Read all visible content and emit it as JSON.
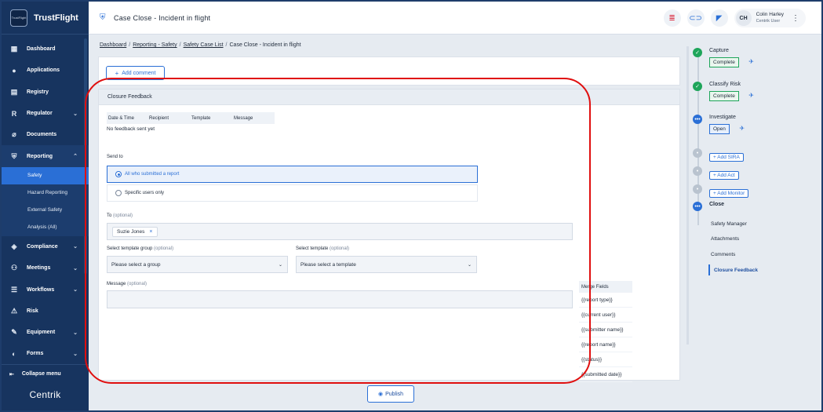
{
  "brand": {
    "name": "TrustFlight",
    "logo_text": "TrustFlight"
  },
  "sidebar": {
    "items": [
      {
        "label": "Dashboard",
        "icon": "dashboard-icon"
      },
      {
        "label": "Applications",
        "icon": "user-icon"
      },
      {
        "label": "Registry",
        "icon": "registry-icon"
      },
      {
        "label": "Regulator",
        "icon": "regulator-icon",
        "letter": "R"
      },
      {
        "label": "Documents",
        "icon": "paperclip-icon"
      },
      {
        "label": "Reporting",
        "icon": "shield-icon"
      },
      {
        "label": "Compliance",
        "icon": "compliance-icon"
      },
      {
        "label": "Meetings",
        "icon": "meetings-icon"
      },
      {
        "label": "Workflows",
        "icon": "workflows-icon"
      },
      {
        "label": "Risk",
        "icon": "risk-icon"
      },
      {
        "label": "Equipment",
        "icon": "wrench-icon"
      },
      {
        "label": "Forms",
        "icon": "forms-icon"
      }
    ],
    "reporting_sub": [
      "Safety",
      "Hazard Reporting",
      "External Safety",
      "Analysis (All)"
    ],
    "collapse_label": "Collapse menu",
    "footer_logo": "Centrik"
  },
  "header": {
    "title": "Case Close - Incident in flight",
    "user_initials": "CH",
    "user_name": "Colin Harley",
    "user_role": "Centrik User"
  },
  "breadcrumb": {
    "items": [
      "Dashboard",
      "Reporting - Safety",
      "Safety Case List",
      "Case Close - Incident in flight"
    ]
  },
  "main": {
    "add_comment_label": "Add comment",
    "panel_title": "Closure Feedback",
    "table_headers": [
      "Date & Time",
      "Recipient",
      "Template",
      "Message"
    ],
    "empty_text": "No feedback sent yet",
    "send_to_label": "Send to",
    "radio_all": "All who submitted a report",
    "radio_specific": "Specific users only",
    "to_label": "To",
    "optional": "(optional)",
    "to_chip": "Suzie Jones",
    "template_group_label": "Select template group",
    "template_group_placeholder": "Please select a group",
    "template_label": "Select template",
    "template_placeholder": "Please select a template",
    "message_label": "Message",
    "merge_fields_title": "Merge Fields",
    "merge_fields": [
      "{{report type}}",
      "{{current user}}",
      "{{submitter name}}",
      "{{report name}}",
      "{{status}}",
      "{{submitted date}}"
    ],
    "publish_label": "Publish"
  },
  "right_panel": {
    "steps": [
      {
        "title": "Capture",
        "status": "Complete"
      },
      {
        "title": "Classify Risk",
        "status": "Complete"
      },
      {
        "title": "Investigate",
        "status": "Open"
      }
    ],
    "add_buttons": [
      "+ Add SIRA",
      "+ Add Act",
      "+ Add Monitor"
    ],
    "close_title": "Close",
    "close_sub": [
      "Safety Manager",
      "Attachments",
      "Comments",
      "Closure Feedback"
    ]
  },
  "colors": {
    "accent": "#2a6fd6",
    "sidebar": "#17345f",
    "success": "#1ea55a",
    "annotation": "#e00f0f"
  }
}
